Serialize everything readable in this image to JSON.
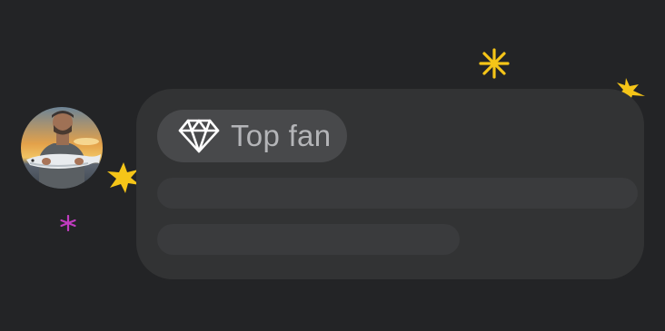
{
  "comment": {
    "badge": {
      "icon": "diamond-icon",
      "label": "Top fan"
    },
    "avatar": {
      "alt": "profile-photo"
    },
    "placeholder_lines": 2
  },
  "decorations": {
    "sparkle_colors": {
      "gold": "#f5c518",
      "magenta": "#c03cbf"
    }
  },
  "colors": {
    "background": "#232426",
    "bubble": "#323334",
    "badge": "#48494b",
    "skeleton": "#3a3b3d",
    "badge_text": "#b4b5b8"
  }
}
